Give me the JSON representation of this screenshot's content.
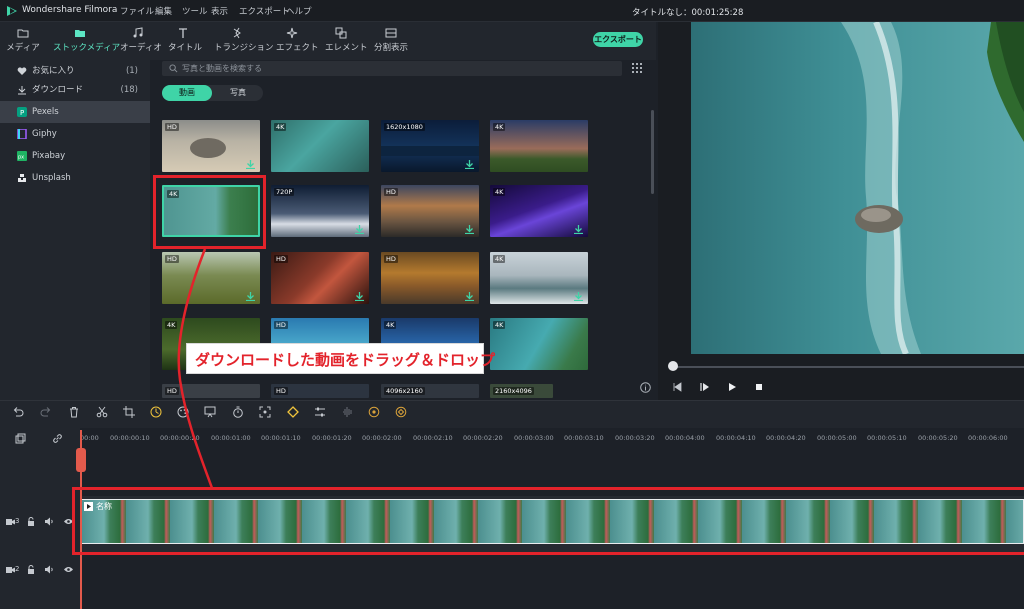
{
  "app": {
    "name": "Wondershare Filmora",
    "project_title": "タイトルなし：00:01:25:28"
  },
  "menu": [
    "ファイル",
    "編集",
    "ツール",
    "表示",
    "エクスポート",
    "ヘルプ"
  ],
  "toolbar": {
    "items": [
      "メディア",
      "ストックメディア",
      "オーディオ",
      "タイトル",
      "トランジション",
      "エフェクト",
      "エレメント",
      "分割表示"
    ],
    "export_label": "エクスポート"
  },
  "sidebar": {
    "items": [
      {
        "label": "お気に入り",
        "count": "(1)"
      },
      {
        "label": "ダウンロード",
        "count": "(18)"
      },
      {
        "label": "Pexels",
        "count": ""
      },
      {
        "label": "Giphy",
        "count": ""
      },
      {
        "label": "Pixabay",
        "count": ""
      },
      {
        "label": "Unsplash",
        "count": ""
      }
    ]
  },
  "search": {
    "placeholder": "写真と動画を検索する"
  },
  "media_tabs": [
    "動画",
    "写真"
  ],
  "thumbnails": {
    "badges": [
      "HD",
      "4K",
      "1620x1080",
      "4K",
      "4K",
      "720P",
      "HD",
      "4K",
      "HD",
      "HD",
      "HD",
      "4K",
      "4K",
      "HD",
      "4K",
      "4K",
      "HD",
      "HD",
      "4096x2160",
      "2160x4096"
    ]
  },
  "callout": {
    "text": "ダウンロードした動画をドラッグ＆ドロップ"
  },
  "timeline": {
    "ruler": [
      "00:00",
      "00:00:00:10",
      "00:00:00:20",
      "00:00:01:00",
      "00:00:01:10",
      "00:00:01:20",
      "00:00:02:00",
      "00:00:02:10",
      "00:00:02:20",
      "00:00:03:00",
      "00:00:03:10",
      "00:00:03:20",
      "00:00:04:00",
      "00:00:04:10",
      "00:00:04:20",
      "00:00:05:00",
      "00:00:05:10",
      "00:00:05:20",
      "00:00:06:00"
    ],
    "clip_label": "名称",
    "track3_label": "3",
    "track2_label": "2"
  },
  "colors": {
    "accent": "#3fd4a7",
    "annotation": "#e3232b",
    "playhead": "#e35a4c"
  }
}
